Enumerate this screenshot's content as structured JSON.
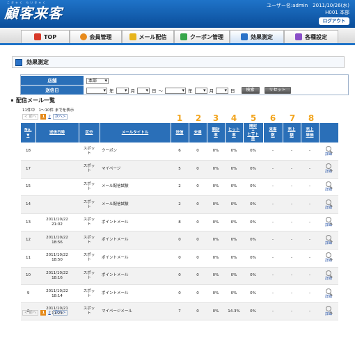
{
  "header": {
    "logo": "顧客来客",
    "logo_ruby": "こきゃく らいきゃく",
    "user_line": "ユーザー名:admin　2011/10/26(水)",
    "shop_line": "H001 本部",
    "logout_label": "ログアウト"
  },
  "nav": {
    "tabs": [
      {
        "label": "TOP",
        "icon": "home-icon"
      },
      {
        "label": "会員管理",
        "icon": "member-icon"
      },
      {
        "label": "メール配信",
        "icon": "mail-icon"
      },
      {
        "label": "クーポン管理",
        "icon": "coupon-icon"
      },
      {
        "label": "効果測定",
        "icon": "chart-icon",
        "active": true
      },
      {
        "label": "各種設定",
        "icon": "settings-icon"
      }
    ]
  },
  "section": {
    "title": "効果測定"
  },
  "form": {
    "shop_label": "店舗",
    "shop_value": "本部",
    "date_label": "送信日",
    "year": "年",
    "month": "月",
    "day": "日",
    "range_sep": "〜",
    "search_label": "検索",
    "reset_label": "リセット"
  },
  "list": {
    "heading": "配信メール一覧",
    "count_text": "11件中　1〜10件 までを表示",
    "pager": {
      "prev": "< 前へ",
      "current": "1",
      "page2": "2",
      "next": "次へ>"
    },
    "column_numbers": [
      "1",
      "2",
      "3",
      "4",
      "5",
      "6",
      "7",
      "8"
    ],
    "headers": {
      "no": "No.\n▼",
      "date": "送信日時",
      "kubun": "区分",
      "title": "メールタイトル",
      "sent": "送信",
      "unread": "未達",
      "open_rate": "開封\n率",
      "hit_rate": "ヒット\n率",
      "open_hit_rate": "開封\n+\nヒット\n率",
      "visitors": "来客\n数",
      "sales": "売上\n額",
      "unit_price": "売上\n単価",
      "detail": ""
    },
    "detail_label": "詳細",
    "rows": [
      {
        "no": "18",
        "date": "",
        "kubun": "スポッ\nト",
        "title": "クーポン",
        "sent": "6",
        "unread": "0",
        "open": "0%",
        "hit": "0%",
        "open_hit": "0%",
        "visitors": "-",
        "sales": "-",
        "unit": "-"
      },
      {
        "no": "17",
        "date": "",
        "kubun": "スポッ\nト",
        "title": "マイページ",
        "sent": "5",
        "unread": "0",
        "open": "0%",
        "hit": "0%",
        "open_hit": "0%",
        "visitors": "-",
        "sales": "-",
        "unit": "-"
      },
      {
        "no": "15",
        "date": "",
        "kubun": "スポッ\nト",
        "title": "メール配信試験",
        "sent": "2",
        "unread": "0",
        "open": "0%",
        "hit": "0%",
        "open_hit": "0%",
        "visitors": "-",
        "sales": "-",
        "unit": "-"
      },
      {
        "no": "14",
        "date": "",
        "kubun": "スポッ\nト",
        "title": "メール配信試験",
        "sent": "2",
        "unread": "0",
        "open": "0%",
        "hit": "0%",
        "open_hit": "0%",
        "visitors": "-",
        "sales": "-",
        "unit": "-"
      },
      {
        "no": "13",
        "date": "2011/10/22\n21:02",
        "kubun": "スポッ\nト",
        "title": "ポイントメール",
        "sent": "8",
        "unread": "0",
        "open": "0%",
        "hit": "0%",
        "open_hit": "0%",
        "visitors": "-",
        "sales": "-",
        "unit": "-"
      },
      {
        "no": "12",
        "date": "2011/10/22\n18:56",
        "kubun": "スポッ\nト",
        "title": "ポイントメール",
        "sent": "0",
        "unread": "0",
        "open": "0%",
        "hit": "0%",
        "open_hit": "0%",
        "visitors": "-",
        "sales": "-",
        "unit": "-"
      },
      {
        "no": "11",
        "date": "2011/10/22\n18:50",
        "kubun": "スポッ\nト",
        "title": "ポイントメール",
        "sent": "0",
        "unread": "0",
        "open": "0%",
        "hit": "0%",
        "open_hit": "0%",
        "visitors": "-",
        "sales": "-",
        "unit": "-"
      },
      {
        "no": "10",
        "date": "2011/10/22\n18:16",
        "kubun": "スポッ\nト",
        "title": "ポイントメール",
        "sent": "0",
        "unread": "0",
        "open": "0%",
        "hit": "0%",
        "open_hit": "0%",
        "visitors": "-",
        "sales": "-",
        "unit": "-"
      },
      {
        "no": "9",
        "date": "2011/10/22\n18:14",
        "kubun": "スポッ\nト",
        "title": "ポイントメール",
        "sent": "0",
        "unread": "0",
        "open": "0%",
        "hit": "0%",
        "open_hit": "0%",
        "visitors": "-",
        "sales": "-",
        "unit": "-"
      },
      {
        "no": "6",
        "date": "2011/10/21\n11:29",
        "kubun": "スポッ\nト",
        "title": "マイページメール",
        "sent": "7",
        "unread": "0",
        "open": "0%",
        "hit": "14.3%",
        "open_hit": "0%",
        "visitors": "-",
        "sales": "-",
        "unit": "-"
      }
    ]
  },
  "colors": {
    "brand_blue": "#1f73c8",
    "header_cell": "#2a6fb8",
    "accent_orange": "#f2a41c",
    "pager_current": "#e58a1a"
  }
}
